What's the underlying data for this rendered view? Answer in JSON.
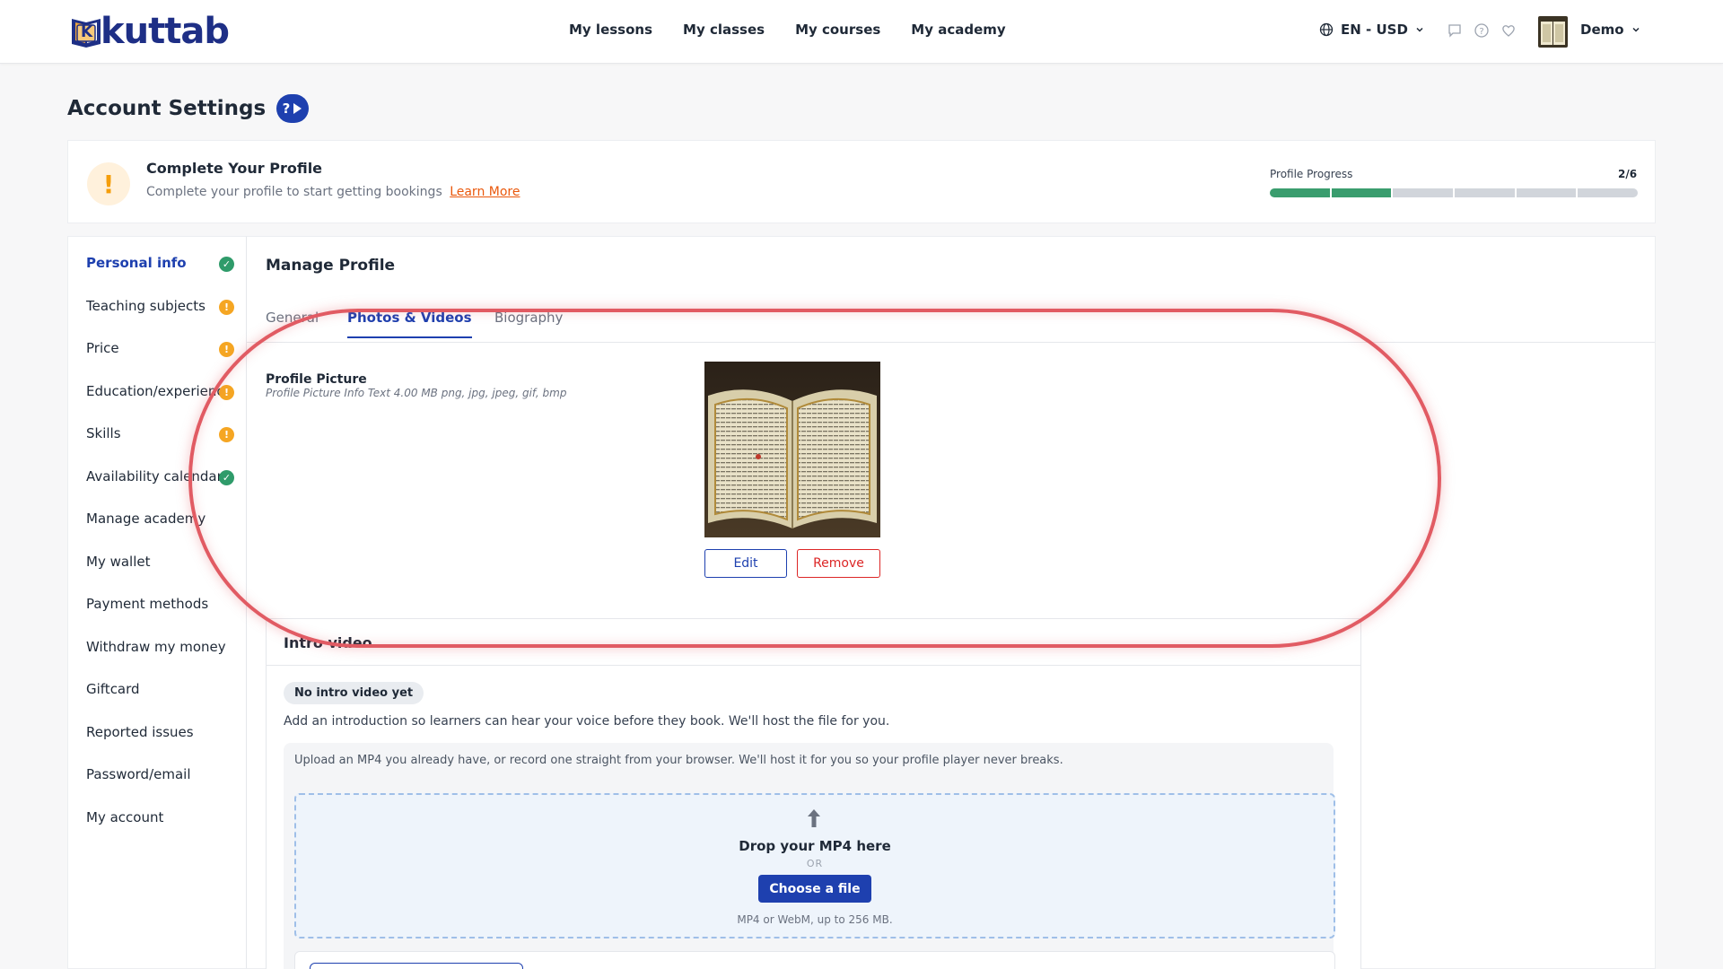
{
  "header": {
    "logo_text": "kuttab",
    "logo_letter": "K",
    "nav": [
      "My lessons",
      "My classes",
      "My courses",
      "My academy"
    ],
    "language": "EN - USD",
    "user_name": "Demo"
  },
  "page": {
    "title": "Account Settings"
  },
  "profile_completion": {
    "title": "Complete Your Profile",
    "subtitle": "Complete your profile to start getting bookings",
    "learn_more": "Learn More",
    "progress_label": "Profile Progress",
    "progress_count": "2/6",
    "progress_done": 2,
    "progress_total": 6
  },
  "sidebar": {
    "items": [
      {
        "label": "Personal info",
        "status": "ok",
        "active": true
      },
      {
        "label": "Teaching subjects",
        "status": "warn"
      },
      {
        "label": "Price",
        "status": "warn"
      },
      {
        "label": "Education/experience",
        "status": "warn"
      },
      {
        "label": "Skills",
        "status": "warn"
      },
      {
        "label": "Availability calendar",
        "status": "ok"
      },
      {
        "label": "Manage academy",
        "status": ""
      },
      {
        "label": "My wallet",
        "status": ""
      },
      {
        "label": "Payment methods",
        "status": ""
      },
      {
        "label": "Withdraw my money",
        "status": ""
      },
      {
        "label": "Giftcard",
        "status": ""
      },
      {
        "label": "Reported issues",
        "status": ""
      },
      {
        "label": "Password/email",
        "status": ""
      },
      {
        "label": "My account",
        "status": ""
      }
    ]
  },
  "main": {
    "title": "Manage Profile",
    "tabs": [
      "General",
      "Photos & Videos",
      "Biography"
    ],
    "active_tab": "Photos & Videos",
    "profile_picture": {
      "label": "Profile Picture",
      "info": "Profile Picture Info Text 4.00 MB png, jpg, jpeg, gif, bmp",
      "edit_label": "Edit",
      "remove_label": "Remove"
    },
    "intro_video": {
      "title": "Intro video",
      "status_pill": "No intro video yet",
      "description": "Add an introduction so learners can hear your voice before they book. We'll host the file for you.",
      "upload_note": "Upload an MP4 you already have, or record one straight from your browser. We'll host it for you so your profile player never breaks.",
      "drop_title": "Drop your MP4 here",
      "drop_or": "OR",
      "choose_label": "Choose a file",
      "drop_hint": "MP4 or WebM, up to 256 MB."
    }
  },
  "colors": {
    "brand": "#1e40af",
    "ok": "#2f9b6a",
    "warn": "#f5a623",
    "danger": "#dc2626",
    "highlight": "#e15b63"
  }
}
